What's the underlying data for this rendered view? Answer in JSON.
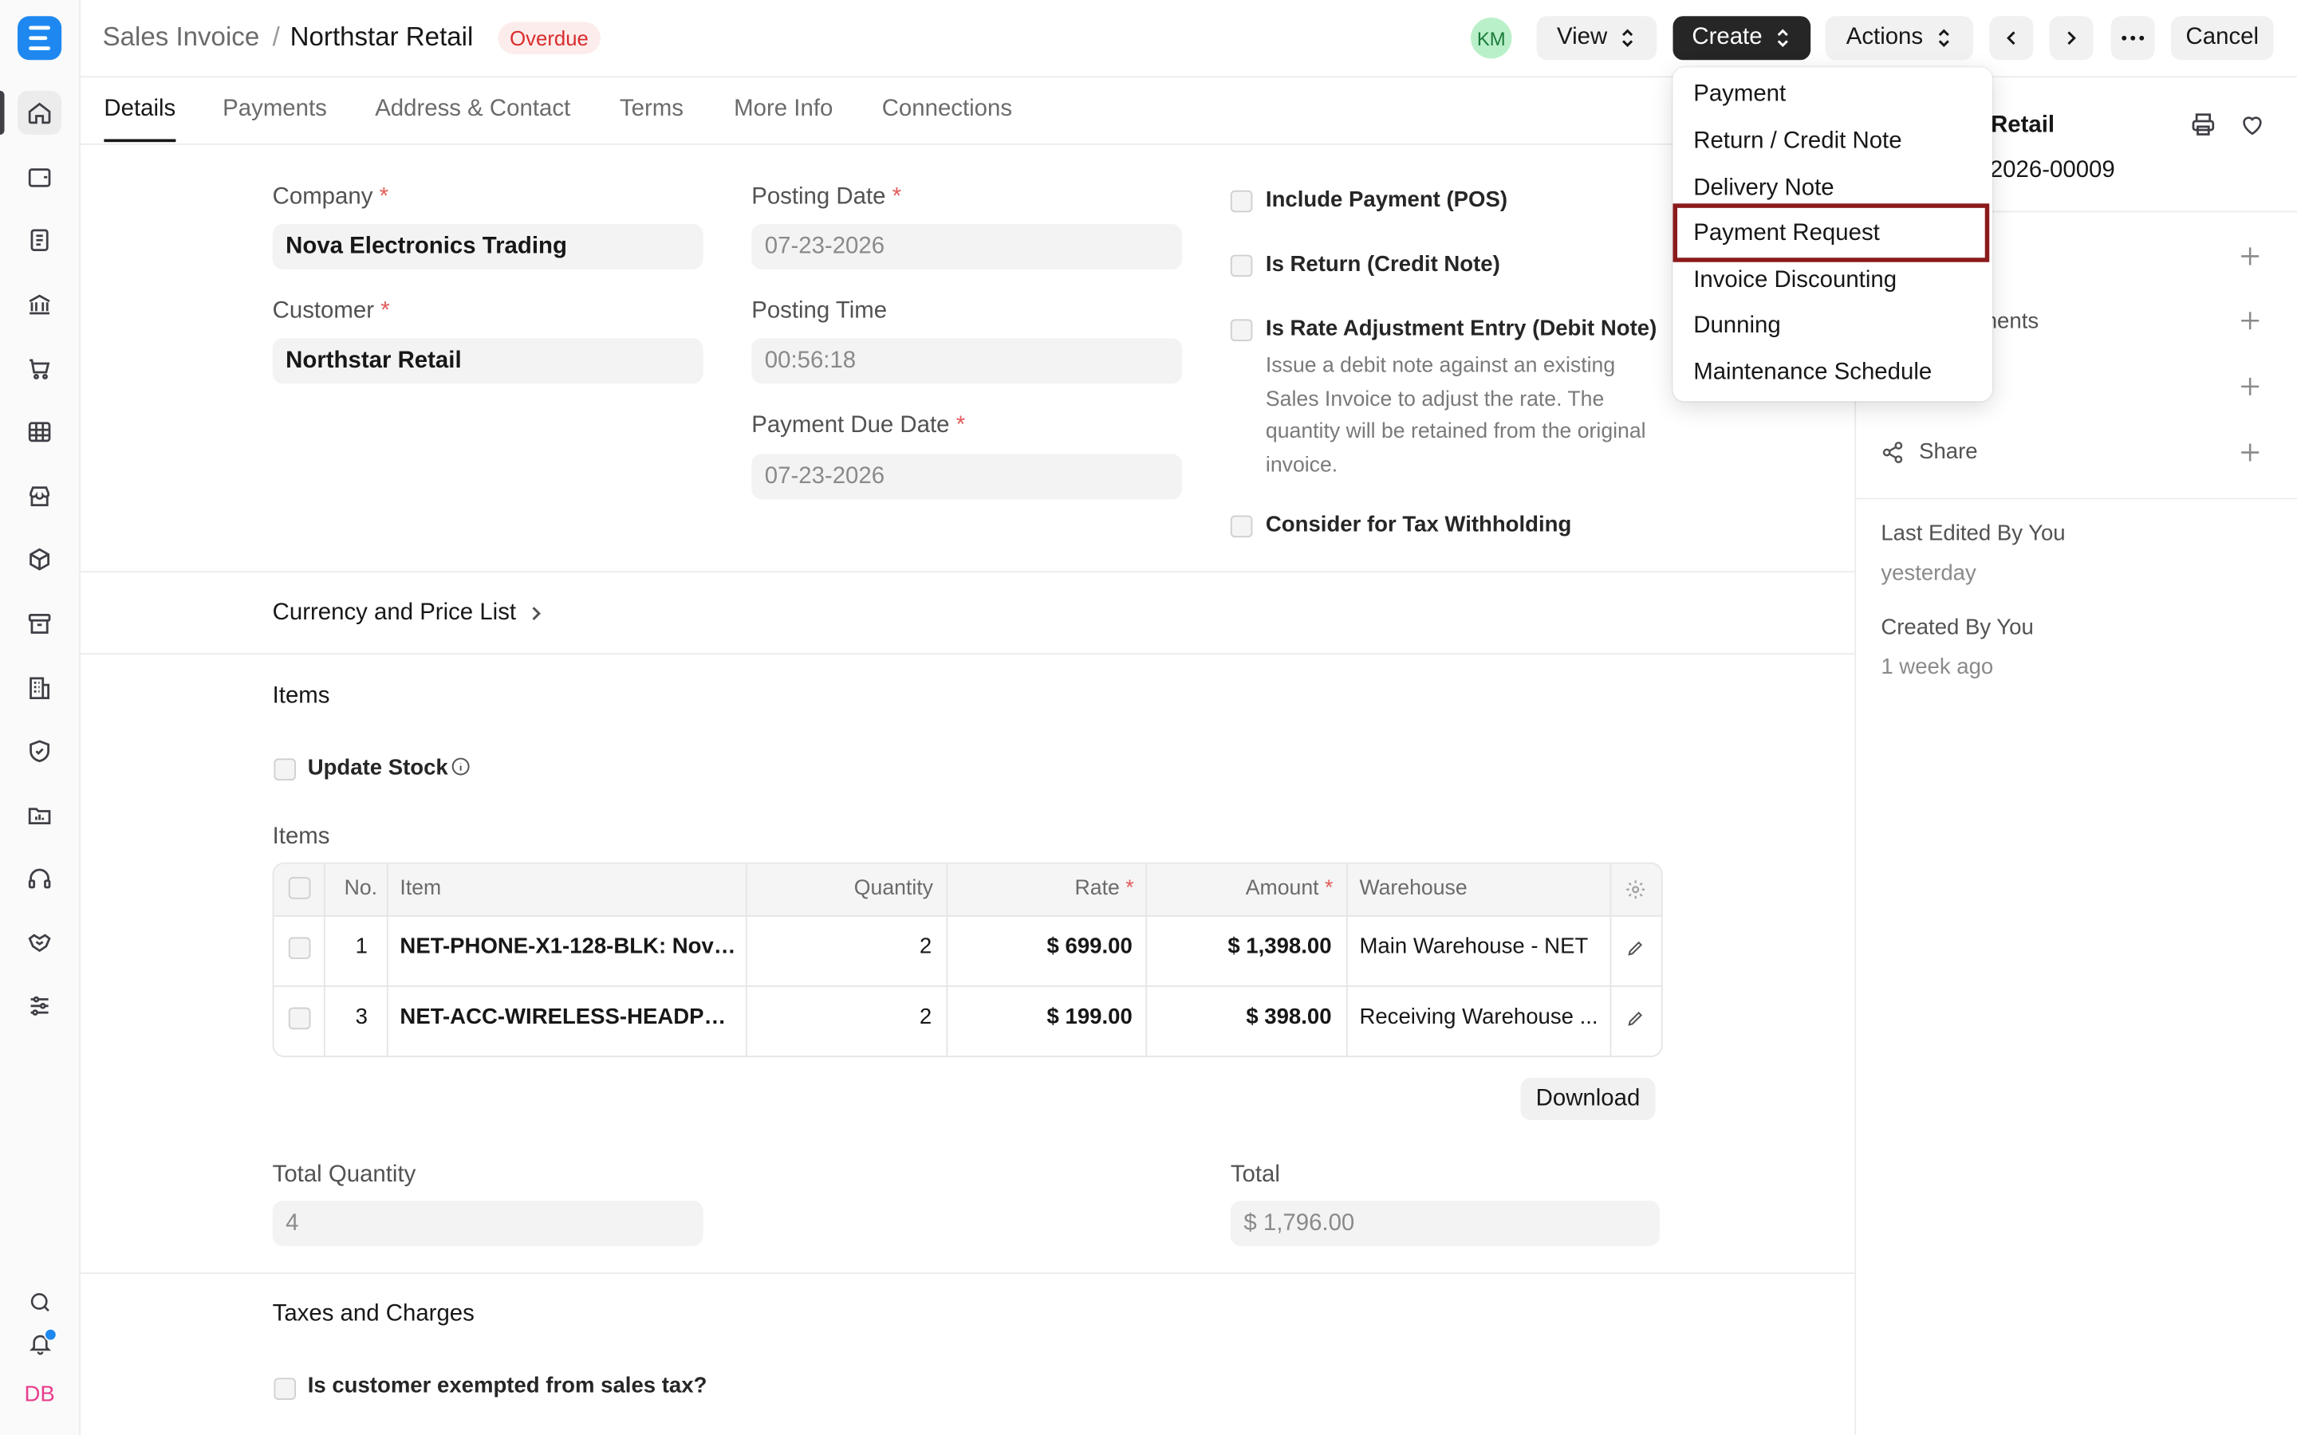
{
  "header": {
    "breadcrumb_parent": "Sales Invoice",
    "breadcrumb_sep": "/",
    "title": "Northstar Retail",
    "status": "Overdue",
    "user_initials": "KM",
    "view_label": "View",
    "create_label": "Create",
    "actions_label": "Actions",
    "cancel_label": "Cancel"
  },
  "tabs": [
    "Details",
    "Payments",
    "Address & Contact",
    "Terms",
    "More Info",
    "Connections"
  ],
  "form": {
    "company_label": "Company",
    "company_value": "Nova Electronics Trading",
    "customer_label": "Customer",
    "customer_value": "Northstar Retail",
    "posting_date_label": "Posting Date",
    "posting_date_value": "07-23-2026",
    "posting_time_label": "Posting Time",
    "posting_time_value": "00:56:18",
    "due_date_label": "Payment Due Date",
    "due_date_value": "07-23-2026",
    "include_payment": "Include Payment (POS)",
    "is_return": "Is Return (Credit Note)",
    "is_rate_adjustment": "Is Rate Adjustment Entry (Debit Note)",
    "rate_adjustment_desc": "Issue a debit note against an existing Sales Invoice to adjust the rate. The quantity will be retained from the original invoice.",
    "tax_withholding": "Consider for Tax Withholding",
    "currency_section": "Currency and Price List",
    "items_section": "Items",
    "update_stock": "Update Stock",
    "items_table_label": "Items",
    "total_qty_label": "Total Quantity",
    "total_qty_value": "4",
    "total_label": "Total",
    "total_value": "$ 1,796.00",
    "taxes_section": "Taxes and Charges",
    "tax_exempt": "Is customer exempted from sales tax?",
    "download_label": "Download"
  },
  "items_table": {
    "columns": {
      "no": "No.",
      "item": "Item",
      "qty": "Quantity",
      "rate": "Rate",
      "amount": "Amount",
      "warehouse": "Warehouse"
    },
    "rows": [
      {
        "no": "1",
        "item": "NET-PHONE-X1-128-BLK: Nova...",
        "qty": "2",
        "rate": "$ 699.00",
        "amount": "$ 1,398.00",
        "warehouse": "Main Warehouse - NET"
      },
      {
        "no": "3",
        "item": "NET-ACC-WIRELESS-HEADPH...",
        "qty": "2",
        "rate": "$ 199.00",
        "amount": "$ 398.00",
        "warehouse": "Receiving Warehouse ..."
      }
    ]
  },
  "right_panel": {
    "title_fragment": "Retail",
    "id_fragment": "-2026-00009",
    "attachments_fragment": "nents",
    "share_label": "Share",
    "last_edited_label": "Last Edited By You",
    "last_edited_value": "yesterday",
    "created_label": "Created By You",
    "created_value": "1 week ago"
  },
  "create_menu": {
    "items": [
      "Payment",
      "Return / Credit Note",
      "Delivery Note",
      "Payment Request",
      "Invoice Discounting",
      "Dunning",
      "Maintenance Schedule"
    ],
    "highlighted": "Payment Request"
  },
  "sidebar": {
    "user_initials": "DB",
    "icons": [
      "home-icon",
      "wallet-icon",
      "document-icon",
      "bank-icon",
      "cart-icon",
      "table-icon",
      "store-icon",
      "package-icon",
      "archive-icon",
      "building-icon",
      "shield-icon",
      "folder-chart-icon",
      "headset-icon",
      "handshake-icon",
      "sliders-icon",
      "search-icon",
      "bell-icon"
    ]
  }
}
